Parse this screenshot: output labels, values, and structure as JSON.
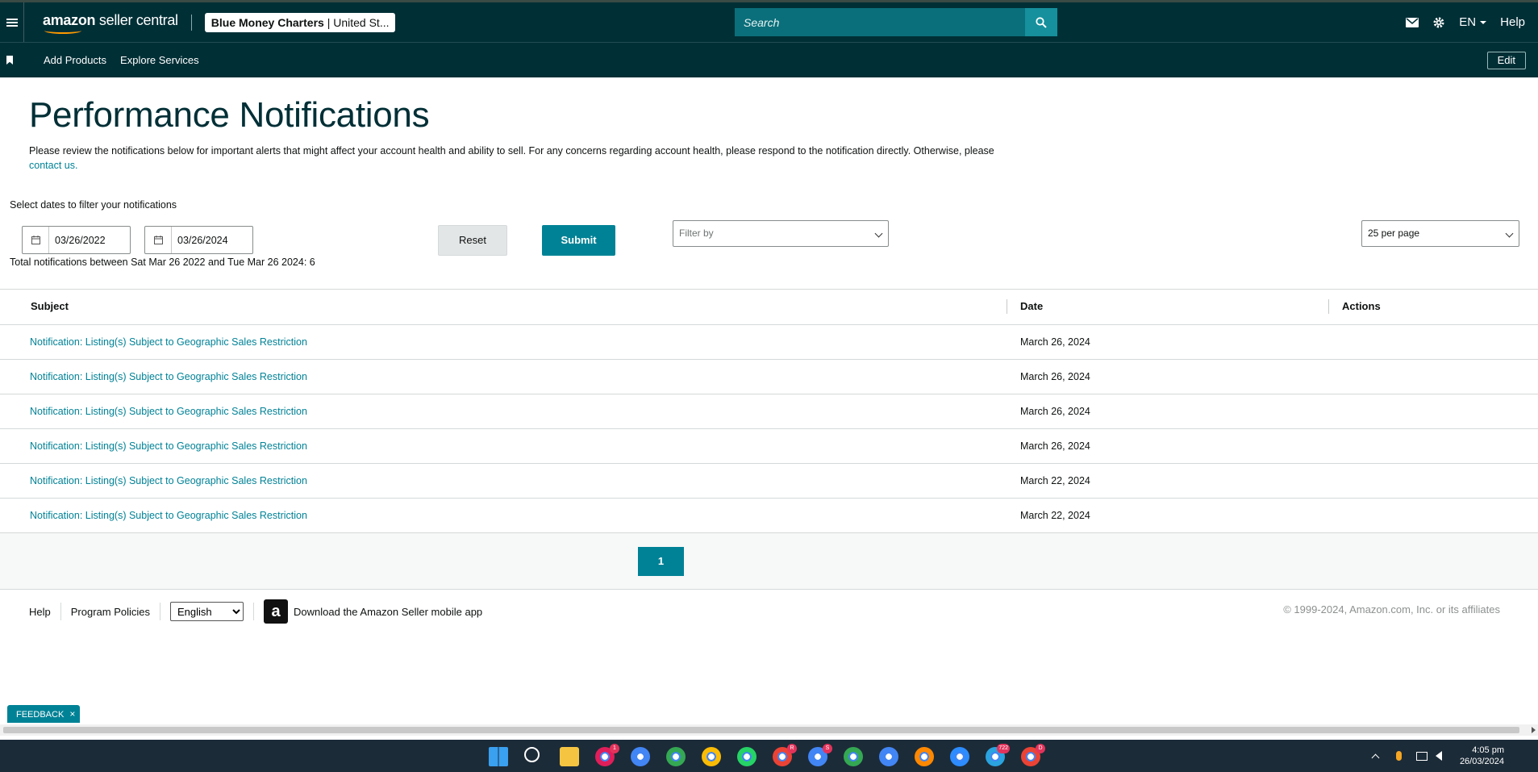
{
  "header": {
    "logo_strong": "amazon",
    "logo_rest": " seller central",
    "account_name": "Blue Money Charters",
    "account_region": " | United St...",
    "search_placeholder": "Search",
    "language": "EN",
    "help": "Help"
  },
  "subnav": {
    "items": [
      "Add Products",
      "Explore Services"
    ],
    "edit": "Edit"
  },
  "page": {
    "title": "Performance Notifications",
    "intro_text": "Please review the notifications below for important alerts that might affect your account health and ability to sell. For any concerns regarding account health, please respond to the notification directly. Otherwise, please ",
    "intro_link": "contact us."
  },
  "filters": {
    "label": "Select dates to filter your notifications",
    "start_date": "03/26/2022",
    "end_date": "03/26/2024",
    "reset": "Reset",
    "submit": "Submit",
    "filter_placeholder": "Filter by",
    "per_page": "25 per page",
    "total": "Total notifications between Sat Mar 26 2022 and Tue Mar 26 2024: 6"
  },
  "table": {
    "headers": [
      "Subject",
      "Date",
      "Actions"
    ],
    "rows": [
      {
        "subject": "Notification: Listing(s) Subject to Geographic Sales Restriction",
        "date": "March 26, 2024"
      },
      {
        "subject": "Notification: Listing(s) Subject to Geographic Sales Restriction",
        "date": "March 26, 2024"
      },
      {
        "subject": "Notification: Listing(s) Subject to Geographic Sales Restriction",
        "date": "March 26, 2024"
      },
      {
        "subject": "Notification: Listing(s) Subject to Geographic Sales Restriction",
        "date": "March 26, 2024"
      },
      {
        "subject": "Notification: Listing(s) Subject to Geographic Sales Restriction",
        "date": "March 22, 2024"
      },
      {
        "subject": "Notification: Listing(s) Subject to Geographic Sales Restriction",
        "date": "March 22, 2024"
      }
    ],
    "page": "1"
  },
  "footer": {
    "help": "Help",
    "policies": "Program Policies",
    "language": "English",
    "app_text": "Download the Amazon Seller mobile app",
    "copyright": "© 1999-2024, Amazon.com, Inc. or its affiliates"
  },
  "feedback": "FEEDBACK",
  "feedback_close": "×",
  "taskbar": {
    "time": "4:05 pm",
    "date": "26/03/2024",
    "icons": [
      {
        "name": "windows-start-icon",
        "color": "#3aa0f0",
        "badge": ""
      },
      {
        "name": "search-icon",
        "color": "#1c2b38",
        "badge": ""
      },
      {
        "name": "file-explorer-icon",
        "color": "#f5c542",
        "badge": ""
      },
      {
        "name": "slack-icon",
        "color": "#e01e5a",
        "badge": "1"
      },
      {
        "name": "chrome-icon",
        "color": "#4285f4",
        "badge": ""
      },
      {
        "name": "chrome-icon",
        "color": "#34a853",
        "badge": ""
      },
      {
        "name": "chrome-icon",
        "color": "#fbbc05",
        "badge": ""
      },
      {
        "name": "whatsapp-icon",
        "color": "#25d366",
        "badge": ""
      },
      {
        "name": "chrome-icon",
        "color": "#ea4335",
        "badge": "R"
      },
      {
        "name": "chrome-icon",
        "color": "#4285f4",
        "badge": "S"
      },
      {
        "name": "chrome-icon",
        "color": "#34a853",
        "badge": ""
      },
      {
        "name": "chrome-icon",
        "color": "#4285f4",
        "badge": ""
      },
      {
        "name": "ringcentral-icon",
        "color": "#ff8800",
        "badge": ""
      },
      {
        "name": "zoom-icon",
        "color": "#2d8cff",
        "badge": ""
      },
      {
        "name": "telegram-icon",
        "color": "#2aa3df",
        "badge": "722"
      },
      {
        "name": "chrome-icon",
        "color": "#ea4335",
        "badge": "D"
      }
    ]
  },
  "colors": {
    "header_bg": "#002f36",
    "accent": "#008296",
    "search_bg": "#0a6f7a"
  }
}
